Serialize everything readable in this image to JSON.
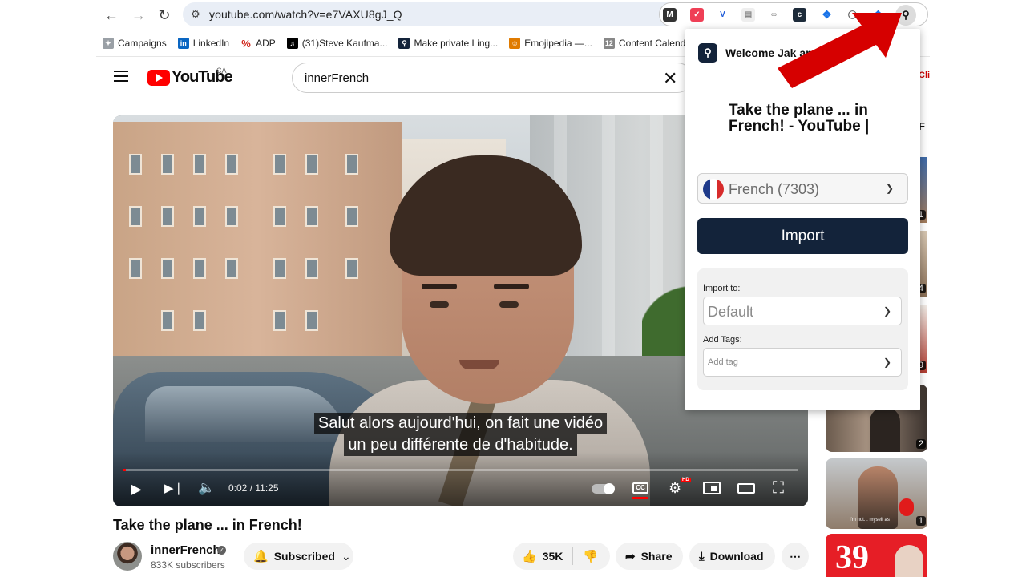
{
  "browser": {
    "url": "youtube.com/watch?v=e7VAXU8gJ_Q",
    "bookmarks": [
      {
        "label": "Campaigns",
        "color": "#9aa0a6"
      },
      {
        "label": "LinkedIn",
        "color": "#0a66c2"
      },
      {
        "label": "ADP",
        "color": "#d0271d"
      },
      {
        "label": "(31)Steve Kaufma...",
        "color": "#000000"
      },
      {
        "label": "Make private Ling...",
        "color": "#13233a"
      },
      {
        "label": "Emojipedia —...",
        "color": "#e07b00"
      },
      {
        "label": "Content Calend",
        "color": "#888888"
      }
    ]
  },
  "youtube": {
    "logo_text": "YouTube",
    "country": "CA",
    "search_query": "innerFrench"
  },
  "video": {
    "subtitle_line1": "Salut alors aujourd'hui, on fait une vidéo",
    "subtitle_line2": "un peu différente de d'habitude.",
    "time": "0:02 / 11:25",
    "progress": 0.003,
    "hd_badge": "HD",
    "cc_label": "CC",
    "title": "Take the plane ... in French!",
    "channel": "innerFrench",
    "subscribers": "833K subscribers",
    "subscribed_label": "Subscribed",
    "likes": "35K",
    "share_label": "Share",
    "download_label": "Download"
  },
  "sidebar": {
    "clip_text": "Cli",
    "thumb_counts": [
      "11",
      "14",
      "19",
      "2",
      "1"
    ],
    "big_number": "39",
    "thumb_caption": "I'm not... myself as"
  },
  "popup": {
    "welcome": "Welcome Jak              am!",
    "title_line1": "Take the plane ... in",
    "title_line2": "French! - YouTube |",
    "language": "French (7303)",
    "import_label": "Import",
    "import_to_label": "Import to:",
    "import_to_value": "Default",
    "tags_label": "Add Tags:",
    "tags_placeholder": "Add tag"
  },
  "colors": {
    "accent_dark": "#13233a",
    "youtube_red": "#ff0000",
    "arrow_red": "#d60000"
  }
}
